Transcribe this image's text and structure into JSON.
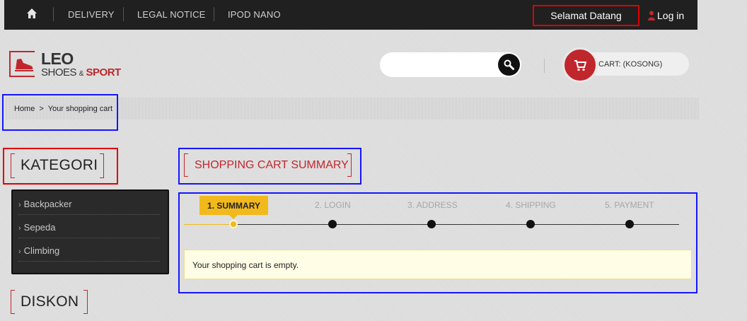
{
  "topbar": {
    "nav": [
      "DELIVERY",
      "LEGAL NOTICE",
      "IPOD NANO"
    ],
    "welcome": "Selamat Datang",
    "login": "Log in"
  },
  "logo": {
    "line1": "LEO",
    "shoes": "SHOES",
    "amp": "&",
    "sport": "SPORT"
  },
  "search": {
    "placeholder": ""
  },
  "cart": {
    "label": "CART: (KOSONG)"
  },
  "breadcrumb": {
    "home": "Home",
    "separator": ">",
    "current": "Your shopping cart"
  },
  "sidebar": {
    "title": "KATEGORI",
    "items": [
      "Backpacker",
      "Sepeda",
      "Climbing"
    ],
    "discount_title": "DISKON"
  },
  "main": {
    "title": "SHOPPING CART SUMMARY",
    "steps": [
      "1. SUMMARY",
      "2. LOGIN",
      "3. ADDRESS",
      "4. SHIPPING",
      "5. PAYMENT"
    ],
    "active_step": 1,
    "empty_message": "Your shopping cart is empty."
  },
  "colors": {
    "brand_red": "#c0272d",
    "step_active": "#f2b91d",
    "topbar": "#202020"
  }
}
